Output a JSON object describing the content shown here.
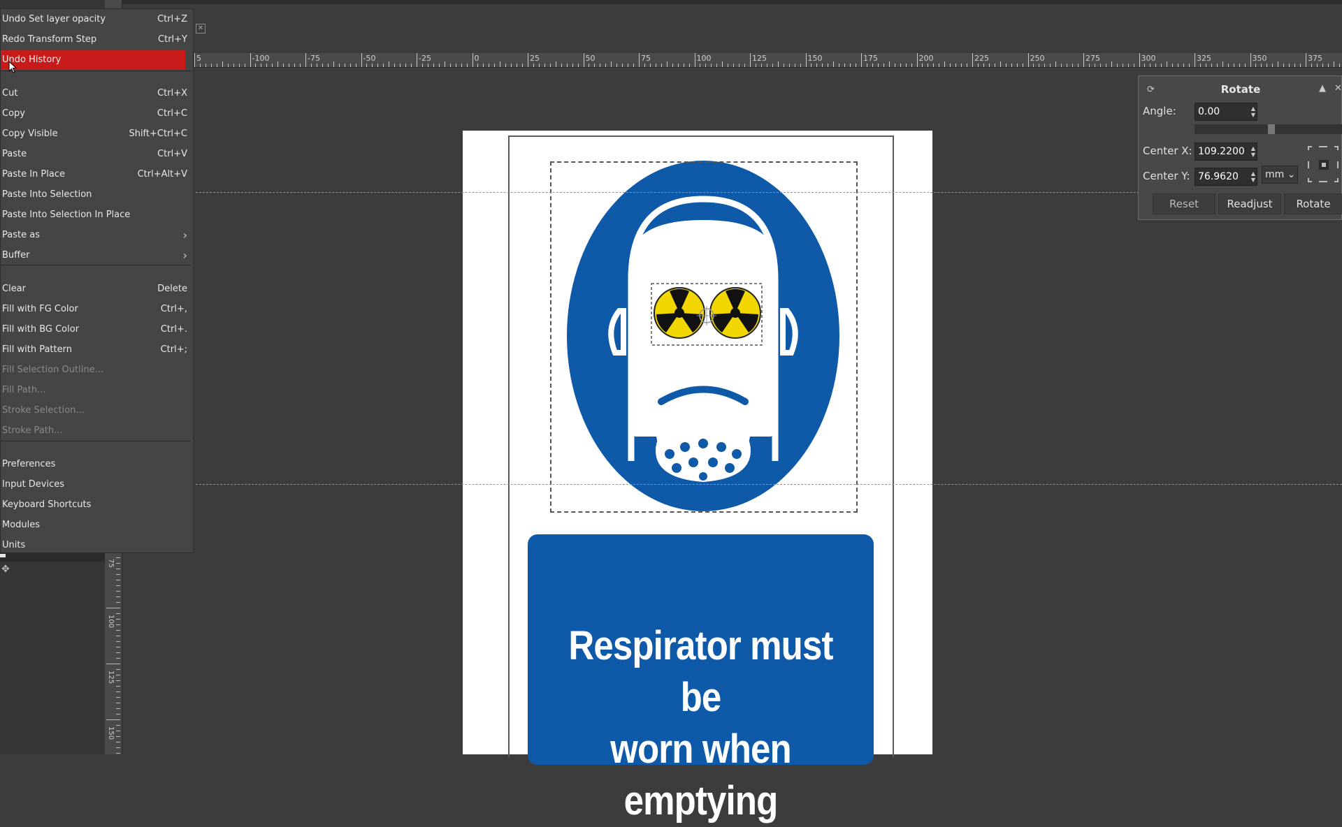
{
  "edit_menu": {
    "items": [
      {
        "label": "Undo Set layer opacity",
        "shortcut": "Ctrl+Z",
        "disabled": false
      },
      {
        "label": "Redo Transform Step",
        "shortcut": "Ctrl+Y",
        "disabled": false
      },
      {
        "label": "Undo History",
        "shortcut": "",
        "disabled": false,
        "active": true
      },
      {
        "label": "Cut",
        "shortcut": "Ctrl+X",
        "disabled": false
      },
      {
        "label": "Copy",
        "shortcut": "Ctrl+C",
        "disabled": false
      },
      {
        "label": "Copy Visible",
        "shortcut": "Shift+Ctrl+C",
        "disabled": false
      },
      {
        "label": "Paste",
        "shortcut": "Ctrl+V",
        "disabled": false
      },
      {
        "label": "Paste In Place",
        "shortcut": "Ctrl+Alt+V",
        "disabled": false
      },
      {
        "label": "Paste Into Selection",
        "shortcut": "",
        "disabled": false
      },
      {
        "label": "Paste Into Selection In Place",
        "shortcut": "",
        "disabled": false
      },
      {
        "label": "Paste as",
        "shortcut": "",
        "submenu": true
      },
      {
        "label": "Buffer",
        "shortcut": "",
        "submenu": true
      },
      {
        "label": "Clear",
        "shortcut": "Delete",
        "disabled": false
      },
      {
        "label": "Fill with FG Color",
        "shortcut": "Ctrl+,",
        "disabled": false
      },
      {
        "label": "Fill with BG Color",
        "shortcut": "Ctrl+.",
        "disabled": false
      },
      {
        "label": "Fill with Pattern",
        "shortcut": "Ctrl+;",
        "disabled": false
      },
      {
        "label": "Fill Selection Outline...",
        "shortcut": "",
        "disabled": true
      },
      {
        "label": "Fill Path...",
        "shortcut": "",
        "disabled": true
      },
      {
        "label": "Stroke Selection...",
        "shortcut": "",
        "disabled": true
      },
      {
        "label": "Stroke Path...",
        "shortcut": "",
        "disabled": true
      },
      {
        "label": "Preferences",
        "shortcut": "",
        "disabled": false
      },
      {
        "label": "Input Devices",
        "shortcut": "",
        "disabled": false
      },
      {
        "label": "Keyboard Shortcuts",
        "shortcut": "",
        "disabled": false
      },
      {
        "label": "Modules",
        "shortcut": "",
        "disabled": false
      },
      {
        "label": "Units",
        "shortcut": "",
        "disabled": false
      }
    ],
    "colors": {
      "active": "#c81b1b",
      "disabled_text": "#8a8a8a"
    }
  },
  "ruler": {
    "labels": [
      "5",
      "-100",
      "-75",
      "-50",
      "-25",
      "0",
      "25",
      "50",
      "75",
      "100",
      "125",
      "150",
      "175",
      "200",
      "225",
      "250",
      "275",
      "300",
      "325",
      "350",
      "375"
    ],
    "vertical_labels": [
      "75",
      "100",
      "125",
      "150"
    ]
  },
  "rotate_dialog": {
    "title": "Rotate",
    "angle_label": "Angle:",
    "angle_value": "0.00",
    "center_x_label": "Center X:",
    "center_x_value": "109.2200",
    "center_y_label": "Center Y:",
    "center_y_value": "76.9620",
    "unit": "mm",
    "buttons": {
      "reset": "Reset",
      "readjust": "Readjust",
      "rotate": "Rotate"
    }
  },
  "sign": {
    "line1": "Respirator must be",
    "line2": "worn when emptying",
    "colors": {
      "blue": "#0f5aa8",
      "hazard_yellow": "#f2d600"
    }
  },
  "icons": [
    "close-icon",
    "move-tool-icon",
    "rotate-tool-icon",
    "pin-icon",
    "chain-link-icon",
    "chevron-right-icon",
    "chevron-down-icon",
    "mouse-cursor-icon",
    "radiation-symbol-icon",
    "respirator-mask-icon"
  ]
}
